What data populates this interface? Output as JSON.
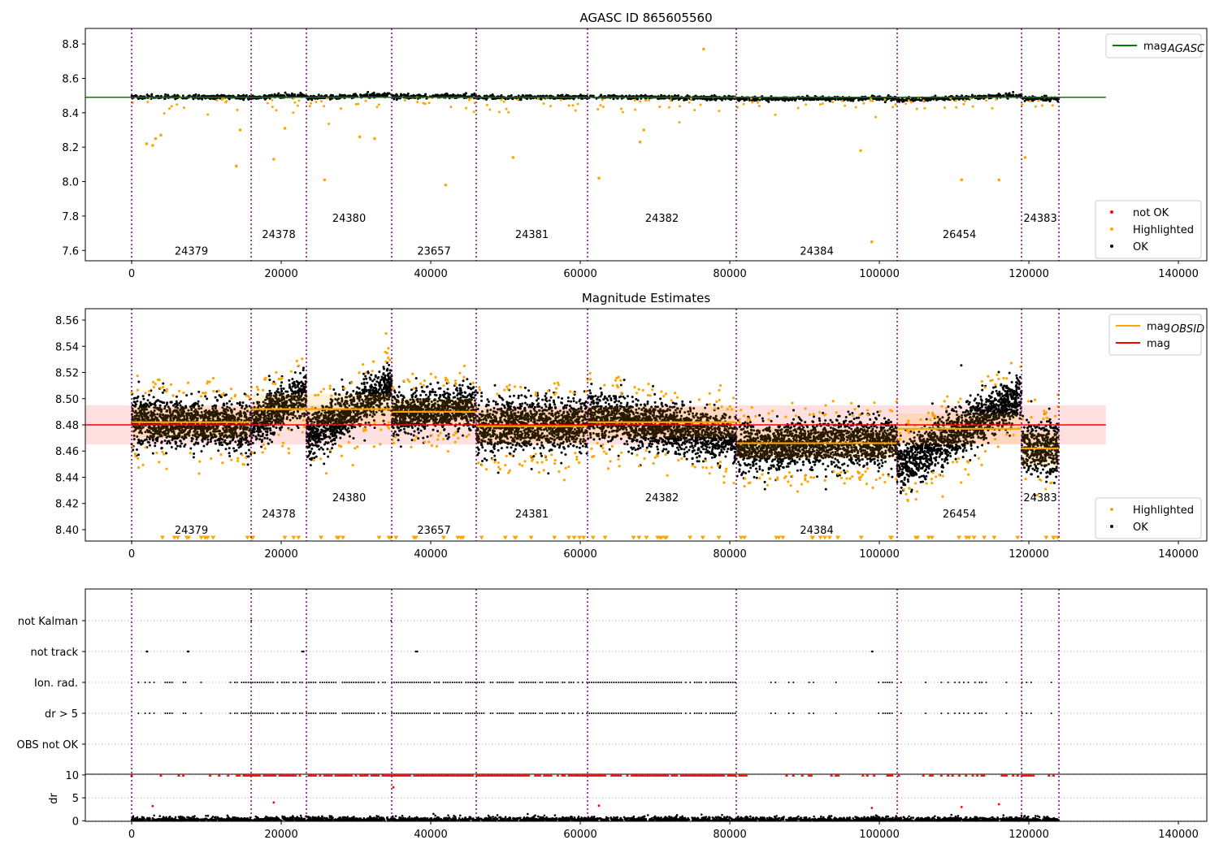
{
  "chart_data": [
    {
      "type": "scatter",
      "title": "AGASC ID 865605560",
      "xlim": [
        -6200,
        143800
      ],
      "ylim": [
        7.54,
        8.89
      ],
      "xticks": [
        0,
        20000,
        40000,
        60000,
        80000,
        100000,
        120000,
        140000
      ],
      "yticks": [
        7.6,
        7.8,
        8.0,
        8.2,
        8.4,
        8.6,
        8.8
      ],
      "ytick_labels": [
        "7.6",
        "7.8",
        "8.0",
        "8.2",
        "8.4",
        "8.6",
        "8.8"
      ],
      "mag_agasc": 8.49,
      "mag_agasc_range": [
        -6200,
        130300
      ],
      "legend_top": [
        {
          "label": "mag",
          "sub": "AGASC",
          "color": "#008000"
        }
      ],
      "legend_bottom": [
        {
          "label": "not OK",
          "color": "#ff0000"
        },
        {
          "label": "Highlighted",
          "color": "#ffa500"
        },
        {
          "label": "OK",
          "color": "#000000"
        }
      ],
      "highlighted_outliers": [
        [
          2000,
          8.22
        ],
        [
          2800,
          8.21
        ],
        [
          3200,
          8.25
        ],
        [
          3900,
          8.27
        ],
        [
          14000,
          8.09
        ],
        [
          14500,
          8.3
        ],
        [
          19000,
          8.13
        ],
        [
          20500,
          8.31
        ],
        [
          25800,
          8.01
        ],
        [
          30500,
          8.26
        ],
        [
          32500,
          8.25
        ],
        [
          42000,
          7.98
        ],
        [
          51000,
          8.14
        ],
        [
          62500,
          8.02
        ],
        [
          68000,
          8.23
        ],
        [
          68500,
          8.3
        ],
        [
          76500,
          8.77
        ],
        [
          97500,
          8.18
        ],
        [
          99000,
          7.65
        ],
        [
          111000,
          8.01
        ],
        [
          116000,
          8.01
        ],
        [
          119500,
          8.14
        ]
      ]
    },
    {
      "type": "scatter",
      "title": "Magnitude Estimates",
      "xlim": [
        -6200,
        143800
      ],
      "ylim": [
        8.3913,
        8.5687
      ],
      "xticks": [
        0,
        20000,
        40000,
        60000,
        80000,
        100000,
        120000,
        140000
      ],
      "yticks": [
        8.4,
        8.42,
        8.44,
        8.46,
        8.48,
        8.5,
        8.52,
        8.54,
        8.56
      ],
      "ytick_labels": [
        "8.40",
        "8.42",
        "8.44",
        "8.46",
        "8.48",
        "8.50",
        "8.52",
        "8.54",
        "8.56"
      ],
      "mag": 8.48,
      "mag_band": [
        8.465,
        8.495
      ],
      "legend_top": [
        {
          "label": "mag",
          "sub": "OBSID",
          "color": "#ffa500"
        },
        {
          "label": "mag",
          "sub": "",
          "color": "#ff0000"
        }
      ],
      "legend_bottom": [
        {
          "label": "Highlighted",
          "color": "#ffa500"
        },
        {
          "label": "OK",
          "color": "#000000"
        }
      ]
    },
    {
      "type": "scatter",
      "flag_rows": [
        "not Kalman",
        "not track",
        "Ion. rad.",
        "dr > 5",
        "OBS not OK"
      ],
      "flag_points": {
        "not Kalman": [
          16000,
          34700
        ],
        "not track": [
          2000,
          2100,
          7500,
          7600,
          22800,
          23000,
          38000,
          38200,
          99000,
          99100
        ],
        "Ion. rad.": "frequent 14000-81000, sparse elsewhere",
        "dr > 5": "frequent 14000-81000, sparse elsewhere"
      },
      "dr_ylabel": "dr",
      "dr_ylim": [
        -0.12,
        10.16
      ],
      "dr_yticks": [
        0,
        5,
        10
      ],
      "dr_ytick_labels": [
        "0",
        "5",
        "10"
      ],
      "dr_clip": 10,
      "xticks": [
        0,
        20000,
        40000,
        60000,
        80000,
        100000,
        120000,
        140000
      ],
      "xtick_labels": [
        "0",
        "20000",
        "40000",
        "60000",
        "80000",
        "100000",
        "120000",
        "140000"
      ]
    }
  ],
  "segments": [
    {
      "obsid": "24379",
      "start": 0,
      "end": 15978,
      "mag_obsid": 8.482,
      "trend": [
        8.484,
        8.478
      ],
      "std": 0.009
    },
    {
      "obsid": "24378",
      "start": 15978,
      "end": 23370,
      "mag_obsid": 8.492,
      "trend": [
        8.48,
        8.505
      ],
      "std": 0.009
    },
    {
      "obsid": "24380",
      "start": 23370,
      "end": 34783,
      "mag_obsid": 8.492,
      "trend": [
        8.47,
        8.51
      ],
      "std": 0.009
    },
    {
      "obsid": "23657",
      "start": 34783,
      "end": 46087,
      "mag_obsid": 8.49,
      "trend": [
        8.488,
        8.494
      ],
      "std": 0.008
    },
    {
      "obsid": "24381",
      "start": 46087,
      "end": 60978,
      "mag_obsid": 8.479,
      "trend": [
        8.478,
        8.482
      ],
      "std": 0.01
    },
    {
      "obsid": "24382",
      "start": 60978,
      "end": 80870,
      "mag_obsid": 8.482,
      "trend": [
        8.487,
        8.47
      ],
      "std": 0.009
    },
    {
      "obsid": "24384",
      "start": 80870,
      "end": 102391,
      "mag_obsid": 8.466,
      "trend": [
        8.462,
        8.468
      ],
      "std": 0.009
    },
    {
      "obsid": "26454",
      "start": 102391,
      "end": 119022,
      "mag_obsid": 8.477,
      "trend": [
        8.448,
        8.502
      ],
      "std": 0.009
    },
    {
      "obsid": "24383",
      "start": 119022,
      "end": 124022,
      "mag_obsid": 8.462,
      "trend": [
        8.462,
        8.462
      ],
      "std": 0.01
    }
  ],
  "colors": {
    "ok": "#000000",
    "highlighted": "#ffa500",
    "not_ok": "#ff0000",
    "agasc": "#008000",
    "mag": "#ff0000",
    "boundary": "#800080"
  }
}
